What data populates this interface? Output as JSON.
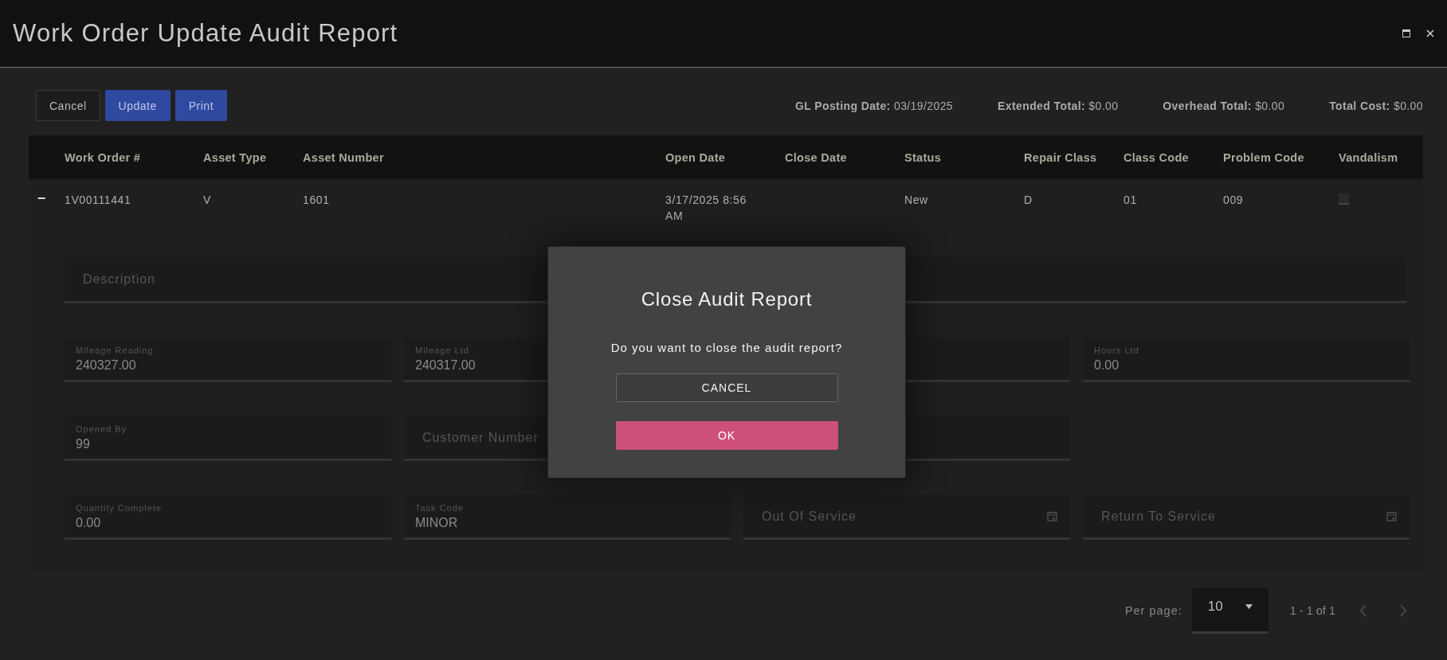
{
  "window": {
    "title": "Work Order Update Audit Report"
  },
  "toolbar": {
    "buttons": [
      {
        "label": "Cancel",
        "kind": "outline"
      },
      {
        "label": "Update",
        "kind": "primary"
      },
      {
        "label": "Print",
        "kind": "primary"
      }
    ],
    "totals": [
      {
        "label": "GL Posting Date:",
        "value": "03/19/2025"
      },
      {
        "label": "Extended Total:",
        "value": "$0.00"
      },
      {
        "label": "Overhead Total:",
        "value": "$0.00"
      },
      {
        "label": "Total Cost:",
        "value": "$0.00"
      }
    ]
  },
  "table": {
    "columns": [
      "Work Order #",
      "Asset Type",
      "Asset Number",
      "Open Date",
      "Close Date",
      "Status",
      "Repair Class",
      "Class Code",
      "Problem Code",
      "Vandalism"
    ],
    "rows": [
      {
        "expander": "−",
        "expanded": true,
        "cells": [
          "1V00111441",
          "V",
          "1601",
          "3/17/2025 8:56 AM",
          "",
          "New",
          "D",
          "01",
          "009"
        ],
        "vandalism_checked": false,
        "details": {
          "description": {
            "placeholder": "Description"
          },
          "field_rows": [
            [
              {
                "kind": "filled",
                "label": "Mileage Reading",
                "value": "240327.00"
              },
              {
                "kind": "filled",
                "label": "Mileage Ltd",
                "value": "240317.00"
              },
              {
                "kind": "covered"
              },
              {
                "kind": "filled",
                "label": "Hours Ltd",
                "value": "0.00"
              }
            ],
            [
              {
                "kind": "filled",
                "label": "Opened By",
                "value": "99"
              },
              {
                "kind": "empty",
                "placeholder": "Customer Number"
              },
              {
                "kind": "covered"
              }
            ],
            [
              {
                "kind": "filled",
                "label": "Quantity Complete",
                "value": "0.00"
              },
              {
                "kind": "filled",
                "label": "Task Code",
                "value": "MINOR"
              },
              {
                "kind": "date",
                "placeholder": "Out Of Service"
              },
              {
                "kind": "date",
                "placeholder": "Return To Service"
              }
            ]
          ]
        }
      }
    ]
  },
  "pagination": {
    "per_page_label": "Per page:",
    "per_page": "10",
    "range": "1 - 1 of 1"
  },
  "dialog": {
    "title": "Close Audit Report",
    "message": "Do you want to close the audit report?",
    "buttons": [
      {
        "label": "CANCEL",
        "kind": "outline"
      },
      {
        "label": "OK",
        "kind": "accent"
      }
    ]
  }
}
